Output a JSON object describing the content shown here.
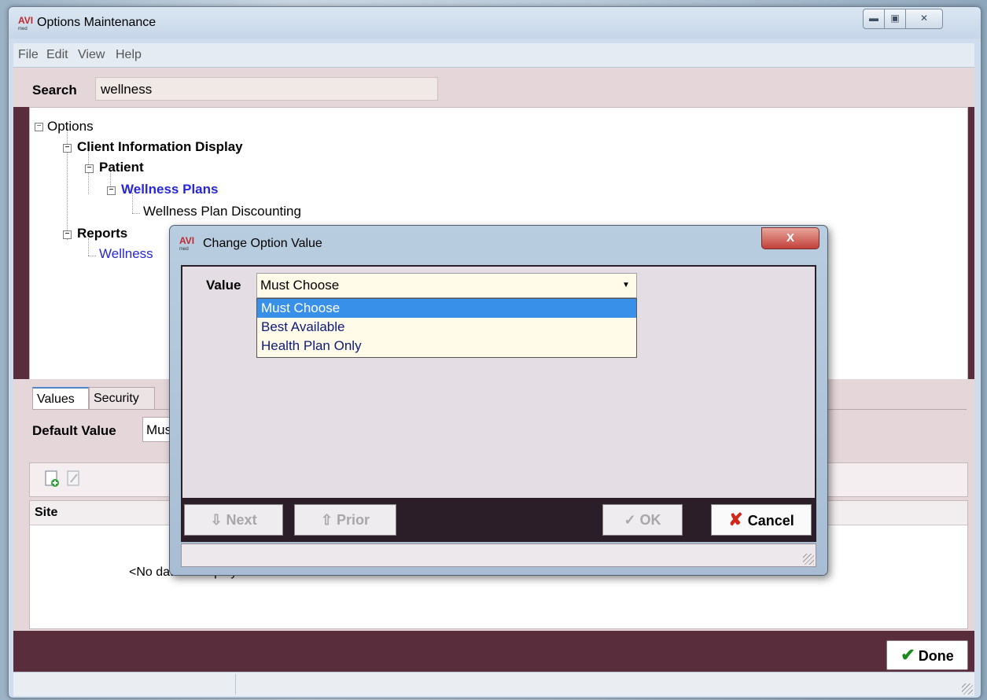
{
  "main_window": {
    "logo": "AVI",
    "logo_sub": "med",
    "title": "Options Maintenance",
    "menu": [
      "File",
      "Edit",
      "View",
      "Help"
    ],
    "search_label": "Search",
    "search_value": "wellness",
    "tree": {
      "root": "Options",
      "client_info": "Client Information Display",
      "patient": "Patient",
      "wellness_plans": "Wellness Plans",
      "wellness_plan_discounting": "Wellness Plan Discounting",
      "reports": "Reports",
      "reports_child": "Wellness"
    },
    "tabs": [
      "Values",
      "Security"
    ],
    "default_value_label": "Default Value",
    "default_value": "Must Choose",
    "grid_column": "Site",
    "no_data": "<No data to display>",
    "done_label": "Done"
  },
  "dialog": {
    "logo": "AVI",
    "logo_sub": "med",
    "title": "Change Option Value",
    "close_symbol": "X",
    "value_label": "Value",
    "value": "Must Choose",
    "options": [
      "Must Choose",
      "Best Available",
      "Health Plan Only"
    ],
    "selected_index": 0,
    "next_label": "Next",
    "prior_label": "Prior",
    "ok_label": "OK",
    "cancel_label": "Cancel"
  },
  "colors": {
    "accent_blue": "#2727d8",
    "selection": "#3990e8",
    "frame": "#5a2d3c",
    "cancel_x": "#d1271c",
    "done_check": "#1a8a1a"
  }
}
